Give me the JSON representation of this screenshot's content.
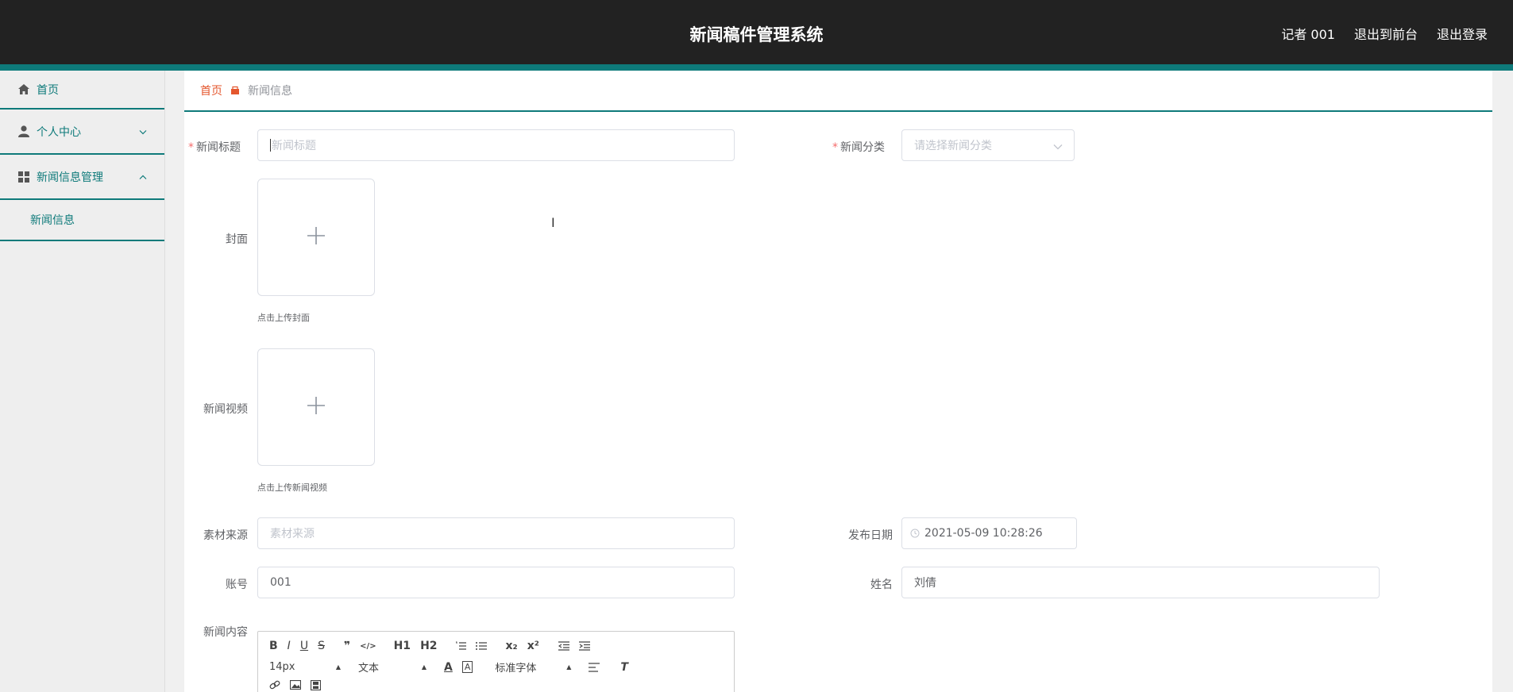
{
  "header": {
    "app_title": "新闻稿件管理系统",
    "links": [
      "记者 001",
      "退出到前台",
      "退出登录"
    ]
  },
  "sidebar": {
    "items": [
      {
        "label": "首页",
        "icon": "home-icon"
      },
      {
        "label": "个人中心",
        "icon": "user-icon",
        "arrow": "chevron-down"
      },
      {
        "label": "新闻信息管理",
        "icon": "grid-icon",
        "arrow": "chevron-up"
      }
    ],
    "submenu": {
      "label": "新闻信息"
    }
  },
  "breadcrumb": {
    "home": "首页",
    "current": "新闻信息"
  },
  "form": {
    "title_label": "新闻标题",
    "title_placeholder": "新闻标题",
    "category_label": "新闻分类",
    "category_placeholder": "请选择新闻分类",
    "cover_label": "封面",
    "cover_tip": "点击上传封面",
    "video_label": "新闻视频",
    "video_tip": "点击上传新闻视频",
    "source_label": "素材来源",
    "source_placeholder": "素材来源",
    "date_label": "发布日期",
    "date_value": "2021-05-09 10:28:26",
    "account_label": "账号",
    "account_value": "001",
    "name_label": "姓名",
    "name_value": "刘倩",
    "content_label": "新闻内容",
    "required_mark": "*"
  },
  "editor": {
    "buttons_row1": [
      "B",
      "I",
      "U",
      "S",
      "❞",
      "</>",
      "H1",
      "H2",
      "ol",
      "ul",
      "x₂",
      "x²",
      "outdent",
      "indent"
    ],
    "font_size": "14px",
    "header_select": "文本",
    "font_family": "标准字体"
  },
  "colors": {
    "accent": "#0e7a7a",
    "header_bg": "#222222",
    "breadcrumb_home": "#e4572e"
  }
}
